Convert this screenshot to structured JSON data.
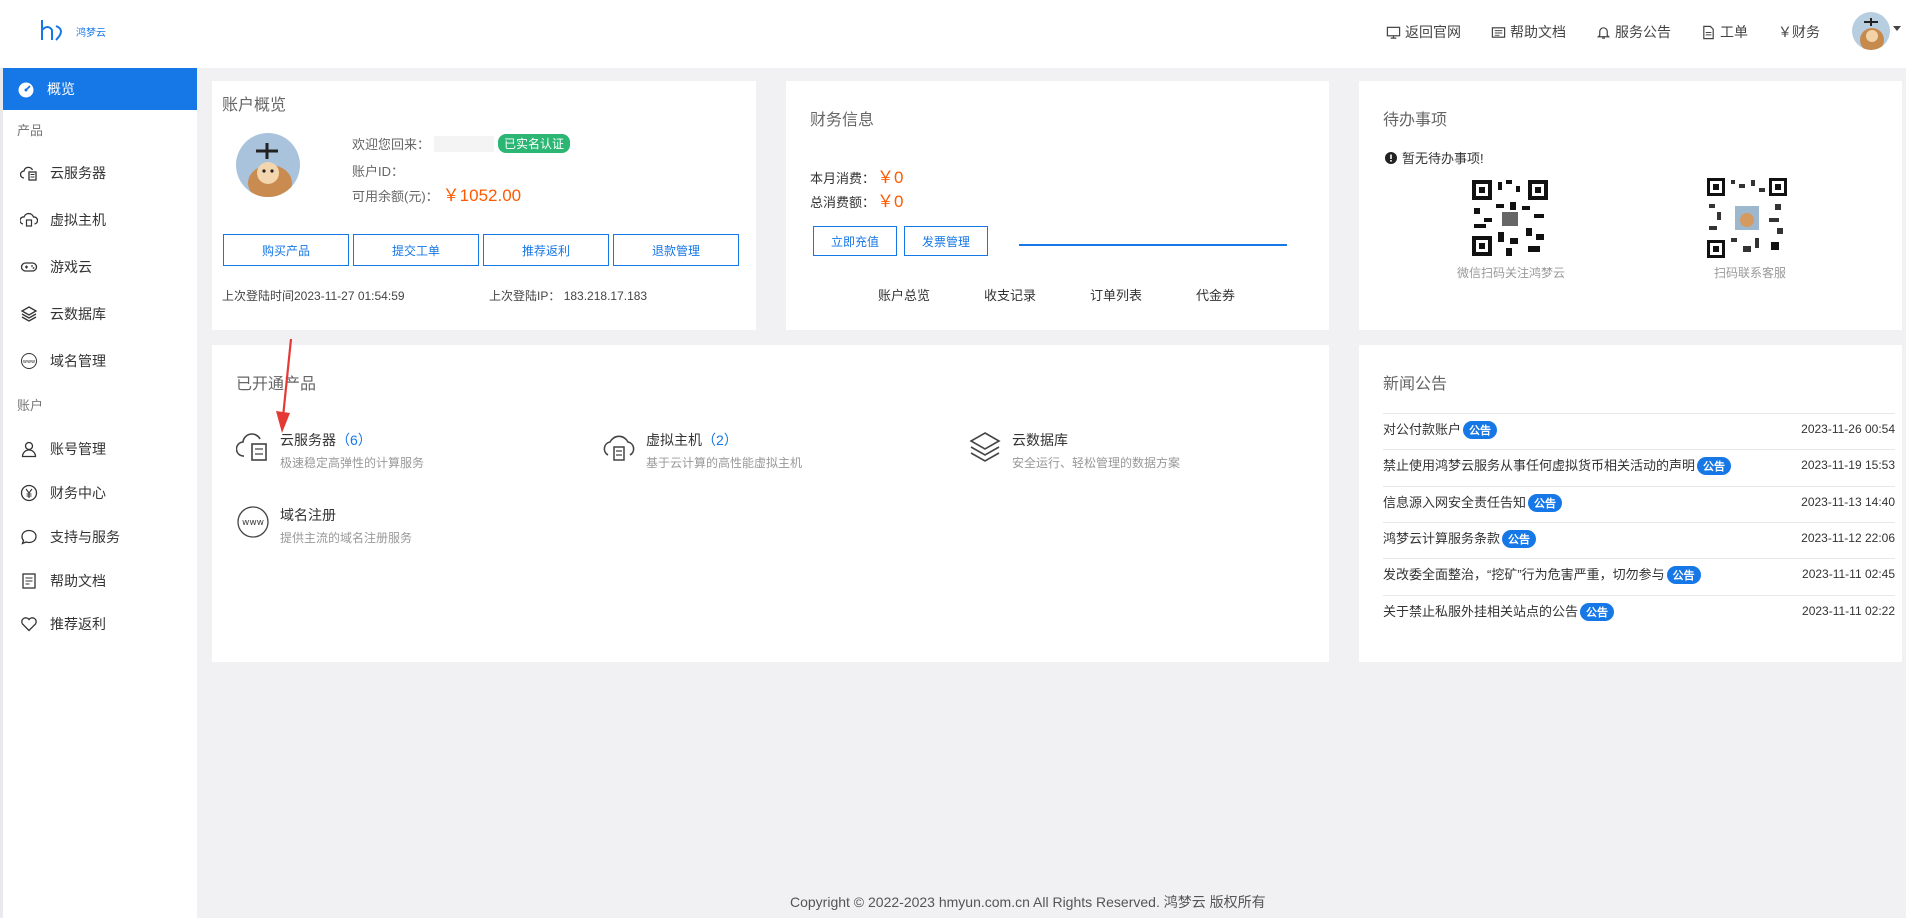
{
  "brand": {
    "name": "鸿梦云"
  },
  "top_nav": [
    {
      "label": "返回官网",
      "icon": "monitor-icon"
    },
    {
      "label": "帮助文档",
      "icon": "document-icon"
    },
    {
      "label": "服务公告",
      "icon": "bell-icon"
    },
    {
      "label": "工单",
      "icon": "ticket-icon"
    },
    {
      "label": "￥财务",
      "icon": ""
    }
  ],
  "sidebar": {
    "active": {
      "label": "概览",
      "icon": "dashboard-icon"
    },
    "section_products": "产品",
    "products": [
      {
        "label": "云服务器",
        "icon": "cloud-server-icon"
      },
      {
        "label": "虚拟主机",
        "icon": "virtual-host-icon"
      },
      {
        "label": "游戏云",
        "icon": "gamepad-icon"
      },
      {
        "label": "云数据库",
        "icon": "database-layers-icon"
      },
      {
        "label": "域名管理",
        "icon": "www-icon"
      }
    ],
    "section_account": "账户",
    "account": [
      {
        "label": "账号管理",
        "icon": "user-icon"
      },
      {
        "label": "财务中心",
        "icon": "yen-icon"
      },
      {
        "label": "支持与服务",
        "icon": "chat-icon"
      },
      {
        "label": "帮助文档",
        "icon": "document-icon"
      },
      {
        "label": "推荐返利",
        "icon": "heart-icon"
      }
    ]
  },
  "overview": {
    "title": "账户概览",
    "welcome": "欢迎您回来：",
    "verified_badge": "已实名认证",
    "account_id_label": "账户ID：",
    "balance_label": "可用余额(元)：",
    "balance_value": "￥1052.00",
    "buttons": [
      "购买产品",
      "提交工单",
      "推荐返利",
      "退款管理"
    ],
    "last_login_time": "上次登陆时间2023-11-27 01:54:59",
    "last_login_ip_label": "上次登陆IP：",
    "last_login_ip": "183.218.17.183"
  },
  "finance": {
    "title": "财务信息",
    "month_label": "本月消费：",
    "month_value": "￥0",
    "total_label": "总消费额：",
    "total_value": "￥0",
    "buttons": [
      "立即充值",
      "发票管理"
    ],
    "links": [
      "账户总览",
      "收支记录",
      "订单列表",
      "代金券"
    ]
  },
  "todo": {
    "title": "待办事项",
    "empty_text": "暂无待办事项!",
    "qr_wechat_caption": "微信扫码关注鸿梦云",
    "qr_service_caption": "扫码联系客服"
  },
  "products_panel": {
    "title": "已开通产品",
    "items": [
      {
        "name": "云服务器",
        "count": "（6）",
        "desc": "极速稳定高弹性的计算服务",
        "icon": "cloud-server-icon"
      },
      {
        "name": "虚拟主机",
        "count": "（2）",
        "desc": "基于云计算的高性能虚拟主机",
        "icon": "virtual-host-icon"
      },
      {
        "name": "云数据库",
        "count": "",
        "desc": "安全运行、轻松管理的数据方案",
        "icon": "database-layers-icon"
      },
      {
        "name": "域名注册",
        "count": "",
        "desc": "提供主流的域名注册服务",
        "icon": "www-icon"
      }
    ]
  },
  "news": {
    "title": "新闻公告",
    "badge": "公告",
    "items": [
      {
        "title": "对公付款账户",
        "date": "2023-11-26 00:54"
      },
      {
        "title": "禁止使用鸿梦云服务从事任何虚拟货币相关活动的声明",
        "date": "2023-11-19 15:53"
      },
      {
        "title": "信息源入网安全责任告知",
        "date": "2023-11-13 14:40"
      },
      {
        "title": "鸿梦云计算服务条款",
        "date": "2023-11-12 22:06"
      },
      {
        "title": "发改委全面整治，“挖矿”行为危害严重，切勿参与",
        "date": "2023-11-11 02:45"
      },
      {
        "title": "关于禁止私服外挂相关站点的公告",
        "date": "2023-11-11 02:22"
      }
    ]
  },
  "footer": {
    "text": "Copyright © 2022-2023 hmyun.com.cn All Rights Reserved. 鸿梦云 版权所有"
  },
  "colors": {
    "accent": "#1677e6",
    "money": "#ff5a00",
    "verified": "#2bb673"
  }
}
